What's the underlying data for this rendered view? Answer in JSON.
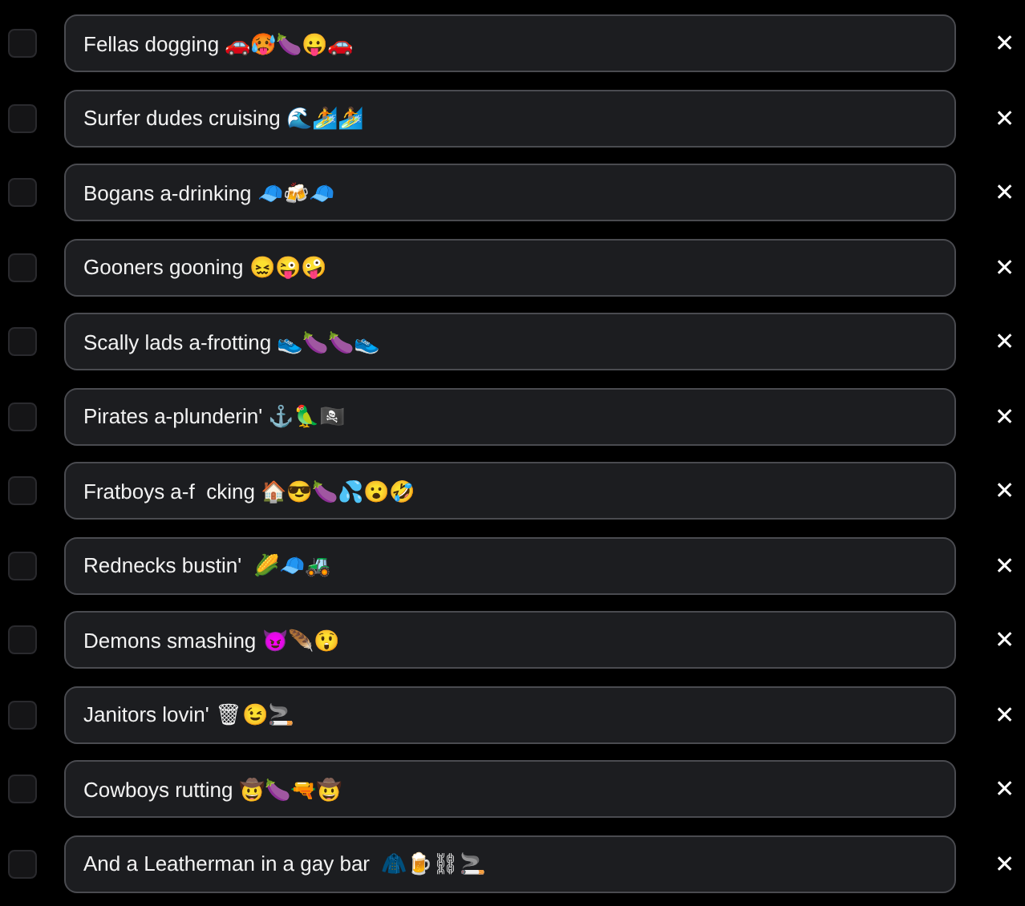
{
  "items": [
    {
      "text": "Fellas dogging 🚗🥵🍆😛🚗",
      "checked": false,
      "remove": "✕"
    },
    {
      "text": "Surfer dudes cruising 🌊🏄🏄",
      "checked": false,
      "remove": "✕"
    },
    {
      "text": "Bogans a-drinking 🧢🍻🧢",
      "checked": false,
      "remove": "✕"
    },
    {
      "text": "Gooners gooning 😖😜🤪",
      "checked": false,
      "remove": "✕"
    },
    {
      "text": "Scally lads a-frotting 👟🍆🍆👟",
      "checked": false,
      "remove": "✕"
    },
    {
      "text": "Pirates a-plunderin' ⚓🦜🏴‍☠️",
      "checked": false,
      "remove": "✕"
    },
    {
      "text": "Fratboys a-f  cking 🏠😎🍆💦😮🤣",
      "checked": false,
      "remove": "✕"
    },
    {
      "text": "Rednecks bustin'  🌽🧢🚜",
      "checked": false,
      "remove": "✕"
    },
    {
      "text": "Demons smashing 😈🪶😲",
      "checked": false,
      "remove": "✕"
    },
    {
      "text": "Janitors lovin' 🗑😉🚬",
      "checked": false,
      "remove": "✕"
    },
    {
      "text": "Cowboys rutting 🤠🍆🔫🤠",
      "checked": false,
      "remove": "✕"
    },
    {
      "text": "And a Leatherman in a gay bar  🧥🍺⛓🚬",
      "checked": false,
      "remove": "✕"
    }
  ]
}
